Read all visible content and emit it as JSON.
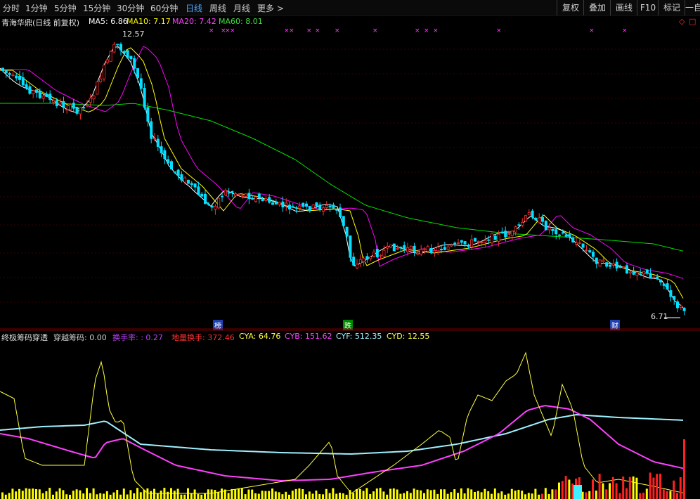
{
  "toolbar": {
    "timeframes": [
      "分时",
      "1分钟",
      "5分钟",
      "15分钟",
      "30分钟",
      "60分钟",
      "日线",
      "周线",
      "月线",
      "更多 >"
    ],
    "active": "日线",
    "right_buttons": [
      "复权",
      "叠加",
      "画线",
      "F10",
      "标记",
      "一自"
    ]
  },
  "price_panel": {
    "stock_name": "青海华鼎(日线 前复权)",
    "ma": [
      {
        "label": "MA5: 6.86",
        "color": "#ffffff"
      },
      {
        "label": "MA10: 7.17",
        "color": "#ffff00"
      },
      {
        "label": "MA20: 7.42",
        "color": "#ff00ff"
      },
      {
        "label": "MA60: 8.01",
        "color": "#00e000"
      }
    ],
    "high_label": "12.57",
    "low_label": "6.71",
    "event_tags": [
      {
        "text": "榜",
        "color": "#3050c0"
      },
      {
        "text": "跌",
        "color": "#00a000"
      },
      {
        "text": "财",
        "color": "#3050c0"
      }
    ],
    "corner_icon": "diamond-icon"
  },
  "indicator_panel": {
    "title": "终极筹码穿透",
    "items": [
      {
        "label": "穿越筹码: 0.00",
        "color": "#d0d0d0"
      },
      {
        "label": "换手率: : 0.27",
        "color": "#c040ff"
      },
      {
        "label": "地量换手: 372.46",
        "color": "#ff3030"
      },
      {
        "label": "CYA: 64.76",
        "color": "#ffff40"
      },
      {
        "label": "CYB: 151.62",
        "color": "#ff40ff"
      },
      {
        "label": "CYF: 512.35",
        "color": "#a0f0ff"
      },
      {
        "label": "CYD: 12.55",
        "color": "#ffff40"
      }
    ]
  },
  "colors": {
    "up": "#ff3030",
    "down": "#00e0ff",
    "ma5": "#ffffff",
    "ma10": "#ffff00",
    "ma20": "#ff00ff",
    "ma60": "#00e000"
  }
}
